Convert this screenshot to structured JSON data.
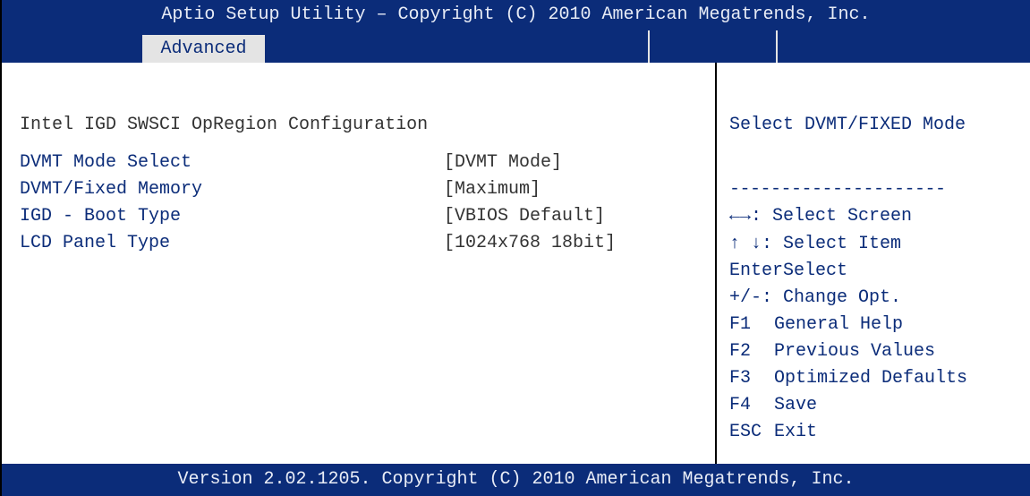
{
  "title": "Aptio Setup Utility – Copyright (C) 2010 American Megatrends, Inc.",
  "tab": {
    "label": "Advanced"
  },
  "section": {
    "title": "Intel IGD SWSCI OpRegion Configuration"
  },
  "settings": [
    {
      "label": "DVMT Mode Select",
      "value": "[DVMT Mode]"
    },
    {
      "label": "DVMT/Fixed Memory",
      "value": "[Maximum]"
    },
    {
      "label": "IGD - Boot Type",
      "value": "[VBIOS Default]"
    },
    {
      "label": "LCD Panel Type",
      "value": "[1024x768 18bit]"
    }
  ],
  "help": {
    "text": "Select DVMT/FIXED Mode",
    "divider": "---------------------"
  },
  "keys": [
    {
      "key": "←→",
      "action": ": Select Screen"
    },
    {
      "key": "↑ ↓",
      "action": ": Select Item"
    },
    {
      "key": "Enter",
      "action": "Select"
    },
    {
      "key": "+/-",
      "action": ": Change Opt."
    },
    {
      "key": "F1",
      "action": "General Help"
    },
    {
      "key": "F2",
      "action": "Previous Values"
    },
    {
      "key": "F3",
      "action": "Optimized Defaults"
    },
    {
      "key": "F4",
      "action": "Save"
    },
    {
      "key": "ESC",
      "action": "Exit"
    }
  ],
  "footer": "Version 2.02.1205. Copyright (C) 2010 American Megatrends, Inc.",
  "colors": {
    "bar": "#0b2c79",
    "tab": "#e4e4e4",
    "text": "#333333"
  }
}
